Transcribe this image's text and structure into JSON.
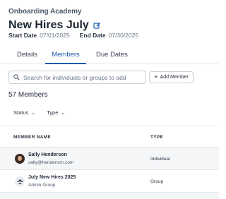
{
  "header": {
    "breadcrumb": "Onboarding Academy",
    "title": "New Hires July",
    "start_label": "Start Date",
    "start_value": "07/01/2025",
    "end_label": "End Date",
    "end_value": "07/30/2025"
  },
  "tabs": [
    {
      "label": "Details",
      "active": false
    },
    {
      "label": "Members",
      "active": true
    },
    {
      "label": "Due Dates",
      "active": false
    }
  ],
  "search": {
    "placeholder": "Search for individuals or groups to add"
  },
  "add_button": {
    "label": "Add Member"
  },
  "members": {
    "count_label": "57 Members",
    "filters": [
      {
        "label": "Status"
      },
      {
        "label": "Type"
      }
    ],
    "columns": [
      "MEMBER NAME",
      "TYPE"
    ],
    "rows": [
      {
        "name": "Sally Henderson",
        "sub": "sally@henderson.com",
        "type": "Individual",
        "icon": "avatar"
      },
      {
        "name": "July New Hires 2025",
        "sub": "Admin Group",
        "type": "Group",
        "icon": "group-icon"
      }
    ]
  },
  "colors": {
    "accent": "#1d5ab0",
    "row_alt": "#f4f6f8",
    "border": "#e3e7ec"
  }
}
